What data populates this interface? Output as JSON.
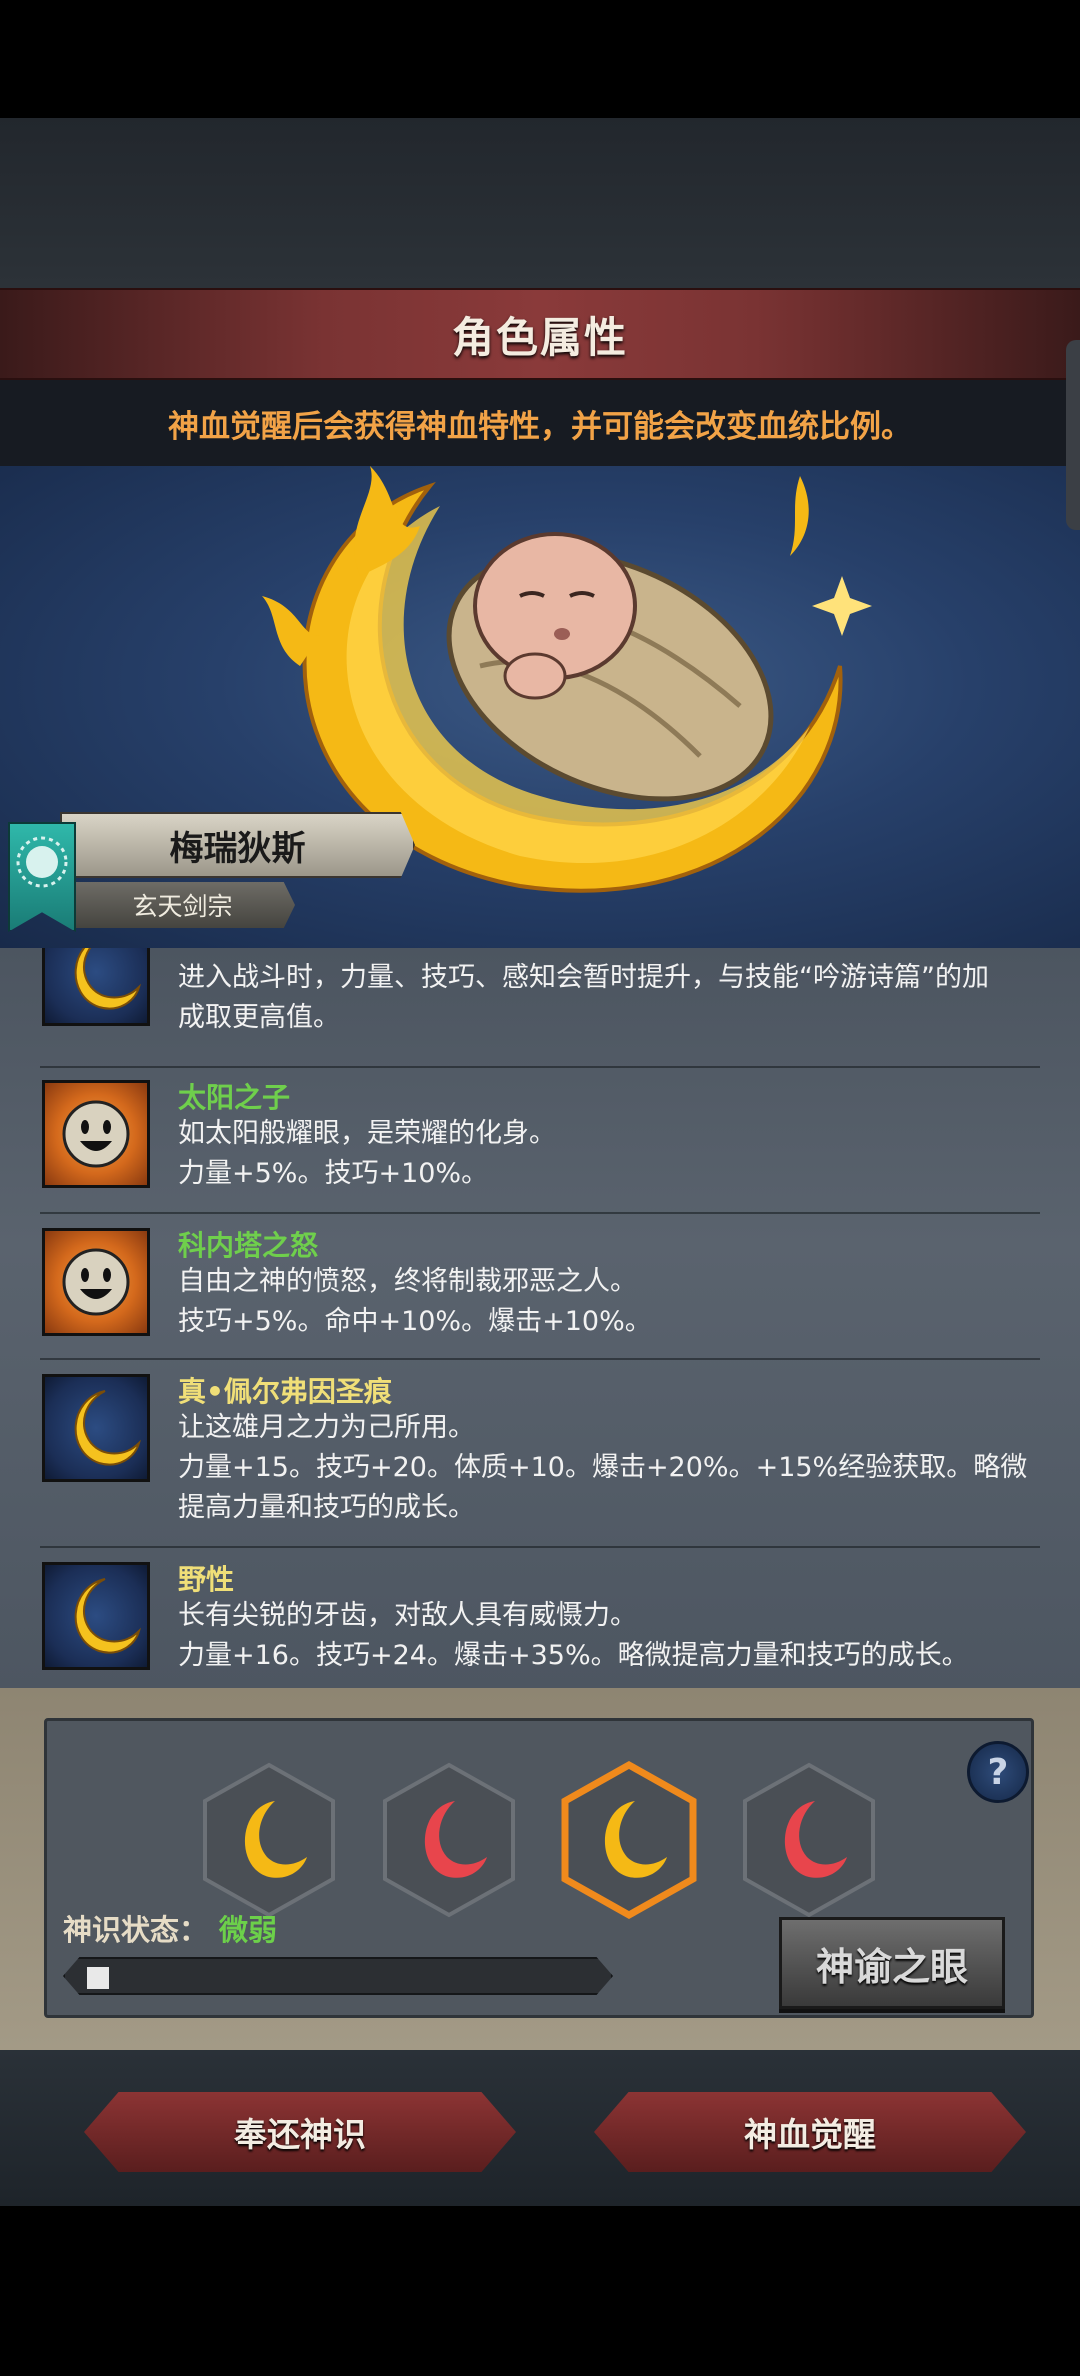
{
  "header": {
    "title": "角色属性",
    "notice": "神血觉醒后会获得神血特性，并可能会改变血统比例。"
  },
  "character": {
    "name": "梅瑞狄斯",
    "sect": "玄天剑宗"
  },
  "traits": [
    {
      "icon": "moon-icon",
      "name": "",
      "color": "#7bd24e",
      "lines": [
        "进入战斗时，力量、技巧、感知会暂时提升，与技能“吟游诗篇”的加",
        "成取更高值。"
      ]
    },
    {
      "icon": "sun-face-icon",
      "name": "太阳之子",
      "color": "#6fcf4c",
      "lines": [
        "如太阳般耀眼，是荣耀的化身。",
        "力量+5%。技巧+10%。"
      ]
    },
    {
      "icon": "sun-face-icon",
      "name": "科内塔之怒",
      "color": "#6fcf4c",
      "lines": [
        "自由之神的愤怒，终将制裁邪恶之人。",
        "技巧+5%。命中+10%。爆击+10%。"
      ]
    },
    {
      "icon": "moon-icon",
      "name": "真•佩尔弗因圣痕",
      "color": "#f0df78",
      "lines": [
        "让这雄月之力为己所用。",
        "力量+15。技巧+20。体质+10。爆击+20%。+15%经验获取。略微",
        "提高力量和技巧的成长。"
      ]
    },
    {
      "icon": "moon-icon",
      "name": "野性",
      "color": "#f0df78",
      "lines": [
        "长有尖锐的牙齿，对敌人具有威慑力。",
        "力量+16。技巧+24。爆击+35%。略微提高力量和技巧的成长。"
      ]
    }
  ],
  "bloodline_slots": [
    {
      "color": "gold",
      "selected": false
    },
    {
      "color": "red",
      "selected": false
    },
    {
      "color": "gold",
      "selected": true
    },
    {
      "color": "red",
      "selected": false
    }
  ],
  "divine_sense": {
    "label": "神识状态：",
    "value": "微弱",
    "progress": 0.04
  },
  "buttons": {
    "help": "?",
    "oracle_eye": "神谕之眼",
    "return_sense": "奉还神识",
    "awaken": "神血觉醒"
  },
  "colors": {
    "title_bar": "#7a3333",
    "notice": "#f2a347",
    "status_value": "#6cd04a",
    "selected_hex": "#f08a1c"
  }
}
